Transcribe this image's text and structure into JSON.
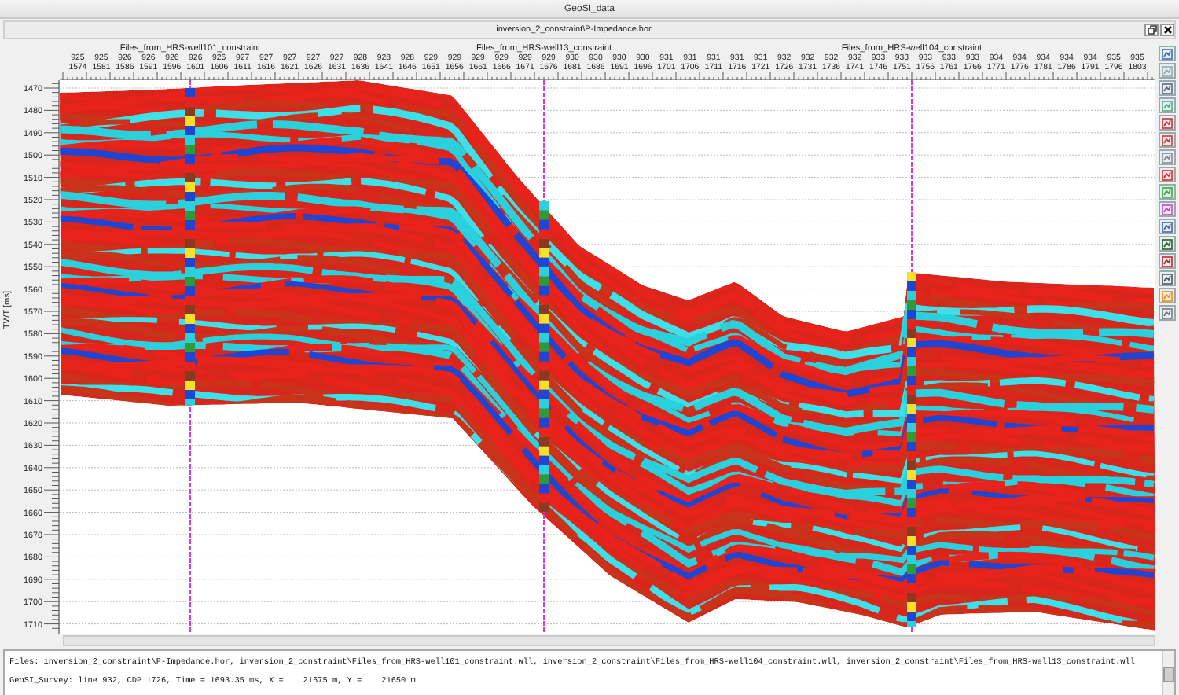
{
  "window": {
    "title": "GeoSI_data"
  },
  "panel": {
    "title": "inversion_2_constraint\\P-Impedance.hor"
  },
  "plot": {
    "y_label": "TWT [ms]",
    "wells": [
      {
        "label": "Files_from_HRS-well101_constraint"
      },
      {
        "label": "Files_from_HRS-well13_constraint"
      },
      {
        "label": "Files_from_HRS-well104_constraint"
      }
    ],
    "x_ticks": [
      {
        "line": "925",
        "cdp": "1574"
      },
      {
        "line": "925",
        "cdp": "1581"
      },
      {
        "line": "926",
        "cdp": "1586"
      },
      {
        "line": "926",
        "cdp": "1591"
      },
      {
        "line": "926",
        "cdp": "1596"
      },
      {
        "line": "926",
        "cdp": "1601"
      },
      {
        "line": "926",
        "cdp": "1606"
      },
      {
        "line": "927",
        "cdp": "1611"
      },
      {
        "line": "927",
        "cdp": "1616"
      },
      {
        "line": "927",
        "cdp": "1621"
      },
      {
        "line": "927",
        "cdp": "1626"
      },
      {
        "line": "927",
        "cdp": "1631"
      },
      {
        "line": "928",
        "cdp": "1636"
      },
      {
        "line": "928",
        "cdp": "1641"
      },
      {
        "line": "928",
        "cdp": "1646"
      },
      {
        "line": "929",
        "cdp": "1651"
      },
      {
        "line": "929",
        "cdp": "1656"
      },
      {
        "line": "929",
        "cdp": "1661"
      },
      {
        "line": "929",
        "cdp": "1666"
      },
      {
        "line": "929",
        "cdp": "1671"
      },
      {
        "line": "929",
        "cdp": "1676"
      },
      {
        "line": "930",
        "cdp": "1681"
      },
      {
        "line": "930",
        "cdp": "1686"
      },
      {
        "line": "930",
        "cdp": "1691"
      },
      {
        "line": "930",
        "cdp": "1696"
      },
      {
        "line": "931",
        "cdp": "1701"
      },
      {
        "line": "931",
        "cdp": "1706"
      },
      {
        "line": "931",
        "cdp": "1711"
      },
      {
        "line": "931",
        "cdp": "1716"
      },
      {
        "line": "931",
        "cdp": "1721"
      },
      {
        "line": "932",
        "cdp": "1726"
      },
      {
        "line": "932",
        "cdp": "1731"
      },
      {
        "line": "932",
        "cdp": "1736"
      },
      {
        "line": "932",
        "cdp": "1741"
      },
      {
        "line": "933",
        "cdp": "1746"
      },
      {
        "line": "933",
        "cdp": "1751"
      },
      {
        "line": "933",
        "cdp": "1756"
      },
      {
        "line": "933",
        "cdp": "1761"
      },
      {
        "line": "933",
        "cdp": "1766"
      },
      {
        "line": "934",
        "cdp": "1771"
      },
      {
        "line": "934",
        "cdp": "1776"
      },
      {
        "line": "934",
        "cdp": "1781"
      },
      {
        "line": "934",
        "cdp": "1786"
      },
      {
        "line": "934",
        "cdp": "1791"
      },
      {
        "line": "935",
        "cdp": "1796"
      },
      {
        "line": "935",
        "cdp": "1803"
      }
    ],
    "y_ticks": [
      "1470",
      "1480",
      "1490",
      "1500",
      "1510",
      "1520",
      "1530",
      "1540",
      "1550",
      "1560",
      "1570",
      "1580",
      "1590",
      "1600",
      "1610",
      "1620",
      "1630",
      "1640",
      "1650",
      "1660",
      "1670",
      "1680",
      "1690",
      "1700",
      "1710"
    ]
  },
  "status": {
    "files": "Files: inversion_2_constraint\\P-Impedance.hor, inversion_2_constraint\\Files_from_HRS-well101_constraint.wll, inversion_2_constraint\\Files_from_HRS-well104_constraint.wll, inversion_2_constraint\\Files_from_HRS-well13_constraint.wll",
    "cursor": "GeoSI_Survey: line 932, CDP 1726, Time = 1693.35 ms, X =    21575 m, Y =    21650 m"
  }
}
